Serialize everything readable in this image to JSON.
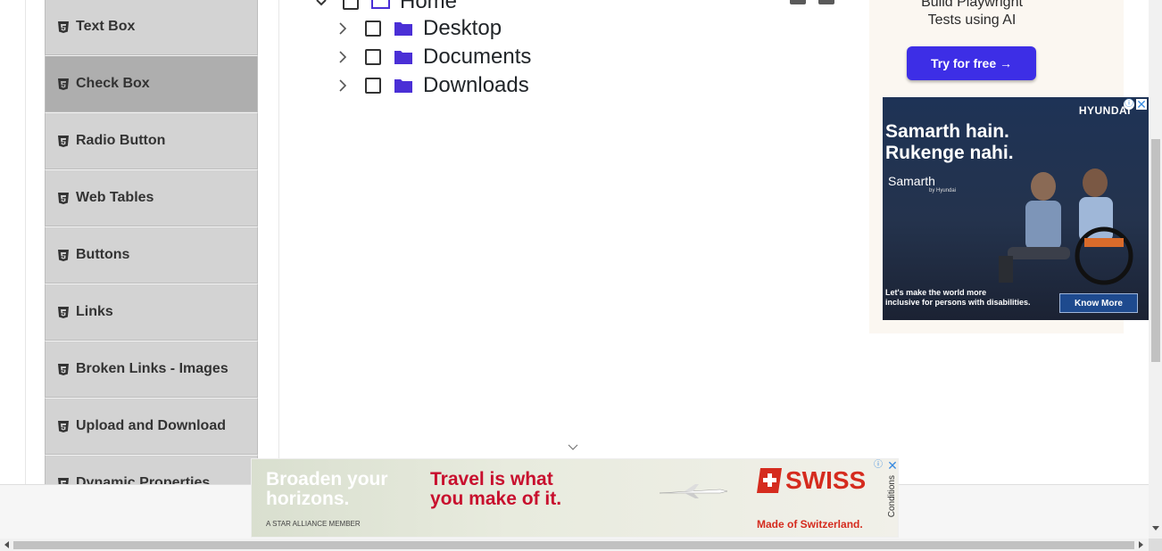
{
  "sidebar": {
    "items": [
      {
        "label": "Text Box",
        "icon": "html5-icon"
      },
      {
        "label": "Check Box",
        "icon": "html5-icon",
        "active": true
      },
      {
        "label": "Radio Button",
        "icon": "html5-icon"
      },
      {
        "label": "Web Tables",
        "icon": "html5-icon"
      },
      {
        "label": "Buttons",
        "icon": "html5-icon"
      },
      {
        "label": "Links",
        "icon": "html5-icon"
      },
      {
        "label": "Broken Links - Images",
        "icon": "html5-icon"
      },
      {
        "label": "Upload and Download",
        "icon": "html5-icon"
      },
      {
        "label": "Dynamic Properties",
        "icon": "html5-icon"
      }
    ]
  },
  "tree": {
    "root": {
      "label": "Home",
      "expanded": true,
      "checked": false
    },
    "children": [
      {
        "label": "Desktop",
        "checked": false,
        "expanded": false
      },
      {
        "label": "Documents",
        "checked": false,
        "expanded": false
      },
      {
        "label": "Downloads",
        "checked": false,
        "expanded": false
      }
    ],
    "folder_color": "#4a2fd6"
  },
  "ads": {
    "top": {
      "headline_line1": "Build Playwright",
      "headline_line2": "Tests using AI",
      "button": "Try for free →"
    },
    "hyundai": {
      "logo": "HYUNDAI",
      "headline_line1": "Samarth hain.",
      "headline_line2": "Rukenge nahi.",
      "brand": "Samarth",
      "brand_sub": "by Hyundai",
      "tagline_line1": "Let's make the world more",
      "tagline_line2": "inclusive for persons with disabilities.",
      "button": "Know More"
    },
    "swiss": {
      "left_line1": "Broaden your",
      "left_line2": "horizons.",
      "mid_line1": "Travel is what",
      "mid_line2": "you make of it.",
      "alliance": "A STAR ALLIANCE MEMBER",
      "brand": "SWISS",
      "footer": "Made of Switzerland.",
      "conditions": "Conditions"
    }
  },
  "colors": {
    "accent_button": "#3d2ee6",
    "swiss_red": "#d52b1e",
    "menu_bg": "#d3d3d3",
    "menu_active_bg": "#aeaeae"
  }
}
